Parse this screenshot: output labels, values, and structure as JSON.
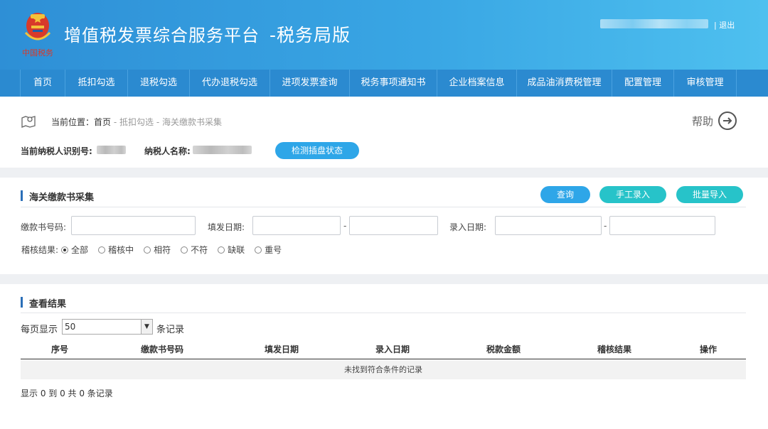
{
  "header": {
    "title": "增值税发票综合服务平台",
    "subtitle": "-税务局版",
    "logo_text": "中国税务",
    "logout": "| 退出"
  },
  "nav": [
    "首页",
    "抵扣勾选",
    "退税勾选",
    "代办退税勾选",
    "进项发票查询",
    "税务事项通知书",
    "企业档案信息",
    "成品油消费税管理",
    "配置管理",
    "审核管理"
  ],
  "location": {
    "prefix": "当前位置：",
    "home": "首页",
    "sep1": " - ",
    "crumb1": "抵扣勾选",
    "sep2": " - ",
    "crumb2": "海关缴款书采集",
    "help": "帮助"
  },
  "taxpayer": {
    "id_label": "当前纳税人识别号:",
    "name_label": "纳税人名称:",
    "check_button": "检测插盘状态"
  },
  "search": {
    "section_title": "海关缴款书采集",
    "query_button": "查询",
    "manual_button": "手工录入",
    "import_button": "批量导入",
    "code_label": "缴款书号码:",
    "issue_date_label": "填发日期:",
    "entry_date_label": "录入日期:",
    "dash": "-",
    "result_label": "稽核结果:",
    "radios": [
      "全部",
      "稽核中",
      "相符",
      "不符",
      "缺联",
      "重号"
    ],
    "selected_radio": "全部"
  },
  "results": {
    "section_title": "查看结果",
    "per_page_label": "每页显示",
    "per_page_value": "50",
    "records_label": "条记录",
    "columns": [
      "序号",
      "缴款书号码",
      "填发日期",
      "录入日期",
      "税款金额",
      "稽核结果",
      "操作"
    ],
    "empty_message": "未找到符合条件的记录",
    "summary": "显示 0 到 0 共 0 条记录"
  },
  "colors": {
    "header_start": "#2e8fd6",
    "header_end": "#4ec0ef",
    "nav_bg": "#2b8ad0",
    "button_blue": "#2ea6e8",
    "button_teal": "#27c3c9"
  }
}
